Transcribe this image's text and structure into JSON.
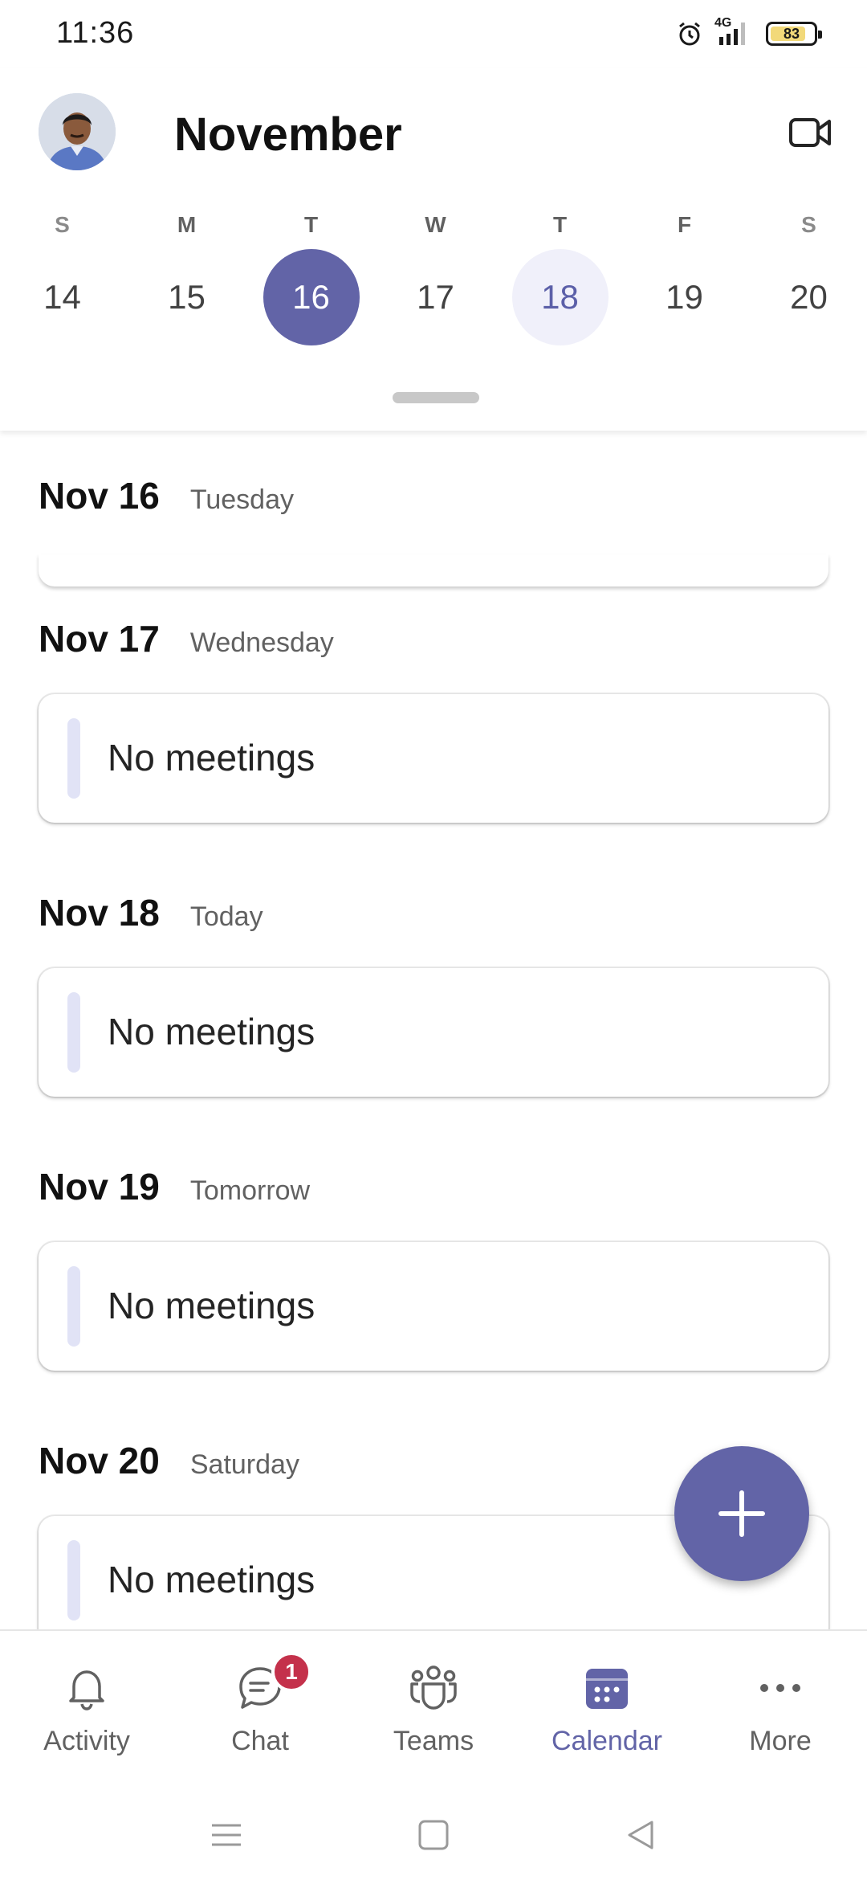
{
  "status_bar": {
    "time": "11:36",
    "network": "4G",
    "battery": "83",
    "battery_level_percent": 83,
    "icons": [
      "alarm-icon",
      "signal-icon",
      "battery-icon"
    ]
  },
  "header": {
    "month": "November",
    "avatar_icon": "profile-photo",
    "video_icon": "video-camera-icon"
  },
  "week": [
    {
      "letter": "S",
      "num": "14"
    },
    {
      "letter": "M",
      "num": "15"
    },
    {
      "letter": "T",
      "num": "16",
      "state": "selected"
    },
    {
      "letter": "W",
      "num": "17"
    },
    {
      "letter": "T",
      "num": "18",
      "state": "today"
    },
    {
      "letter": "F",
      "num": "19"
    },
    {
      "letter": "S",
      "num": "20"
    }
  ],
  "agenda": [
    {
      "date": "Nov 16",
      "label": "Tuesday"
    },
    {
      "date": "Nov 17",
      "label": "Wednesday",
      "card": "No meetings"
    },
    {
      "date": "Nov 18",
      "label": "Today",
      "card": "No meetings"
    },
    {
      "date": "Nov 19",
      "label": "Tomorrow",
      "card": "No meetings"
    },
    {
      "date": "Nov 20",
      "label": "Saturday",
      "card": "No meetings"
    }
  ],
  "fab": {
    "icon": "plus-icon"
  },
  "bottom_nav": [
    {
      "label": "Activity",
      "icon": "bell-icon"
    },
    {
      "label": "Chat",
      "icon": "chat-icon",
      "badge": "1"
    },
    {
      "label": "Teams",
      "icon": "teams-icon"
    },
    {
      "label": "Calendar",
      "icon": "calendar-icon",
      "active": true
    },
    {
      "label": "More",
      "icon": "more-icon"
    }
  ],
  "colors": {
    "accent": "#6264a7",
    "today_bg": "#f0f0fa",
    "badge": "#c4314b",
    "card_bar": "#e1e3f6"
  }
}
